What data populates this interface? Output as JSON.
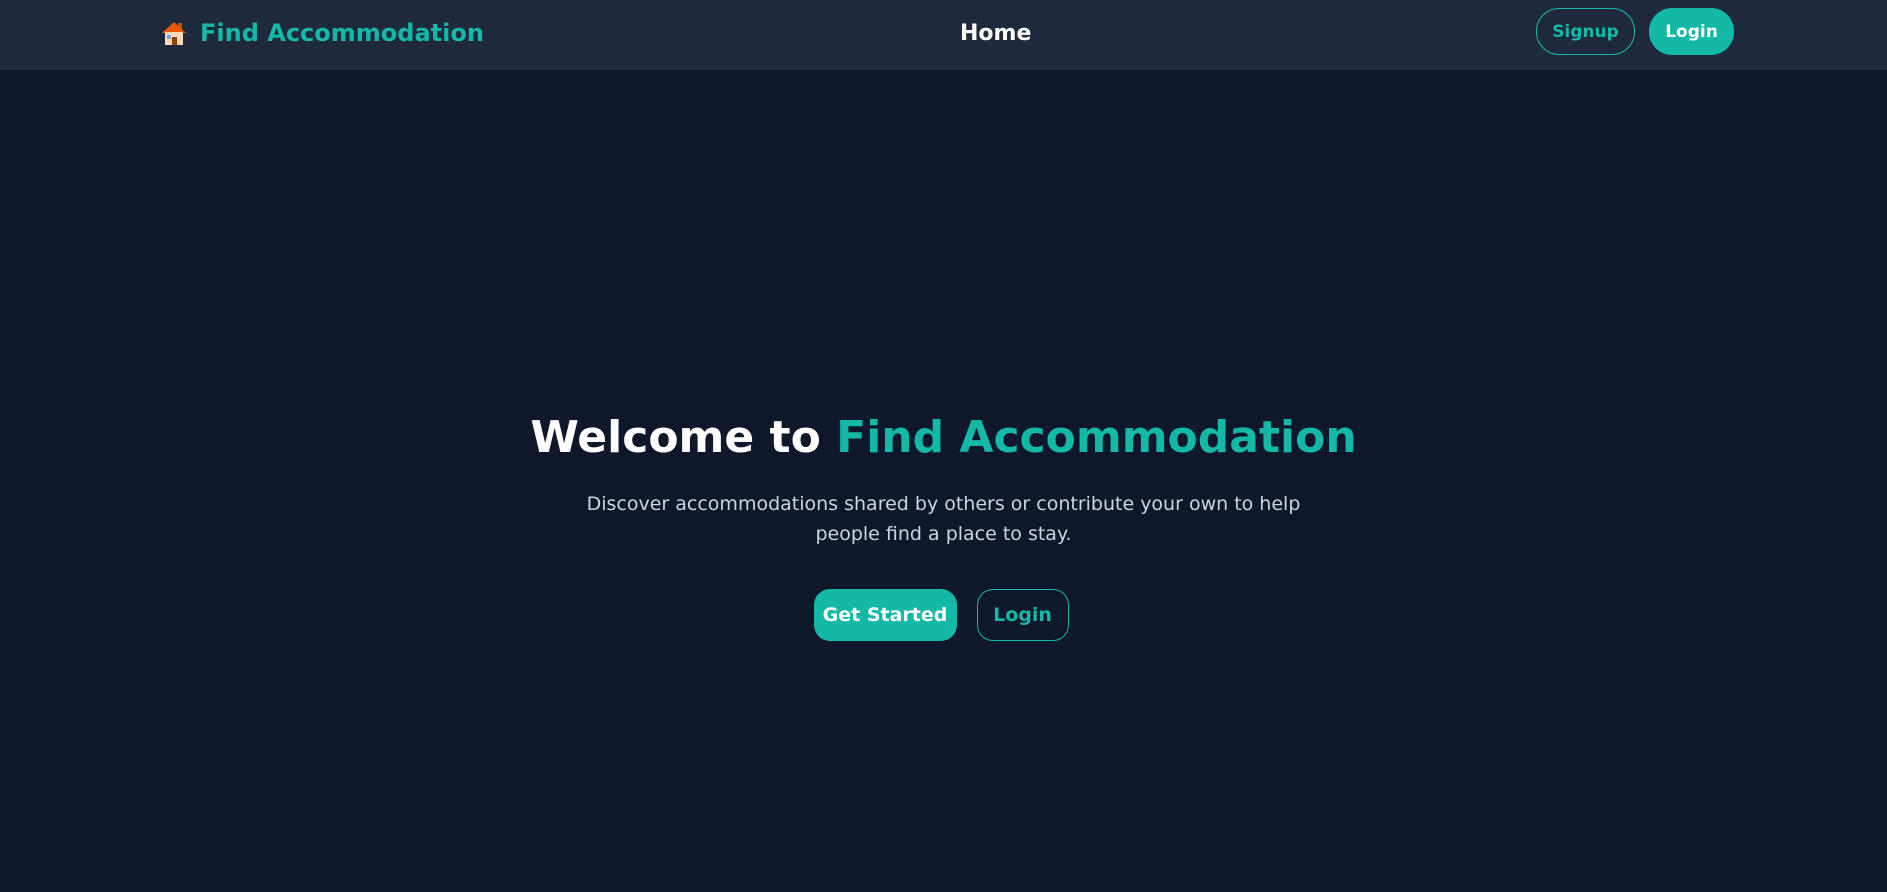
{
  "colors": {
    "background": "#0f172a",
    "navbar": "#1e293b",
    "accent": "#14b8a6",
    "text": "#ffffff",
    "muted": "#cbd5e1"
  },
  "navbar": {
    "brand_icon": "house-icon",
    "brand_name": "Find Accommodation",
    "home_link": "Home",
    "signup_label": "Signup",
    "login_label": "Login"
  },
  "hero": {
    "title_prefix": "Welcome to ",
    "title_accent": "Find Accommodation",
    "description": "Discover accommodations shared by others or contribute your own to help people find a place to stay.",
    "primary_button": "Get Started",
    "secondary_button": "Login"
  }
}
